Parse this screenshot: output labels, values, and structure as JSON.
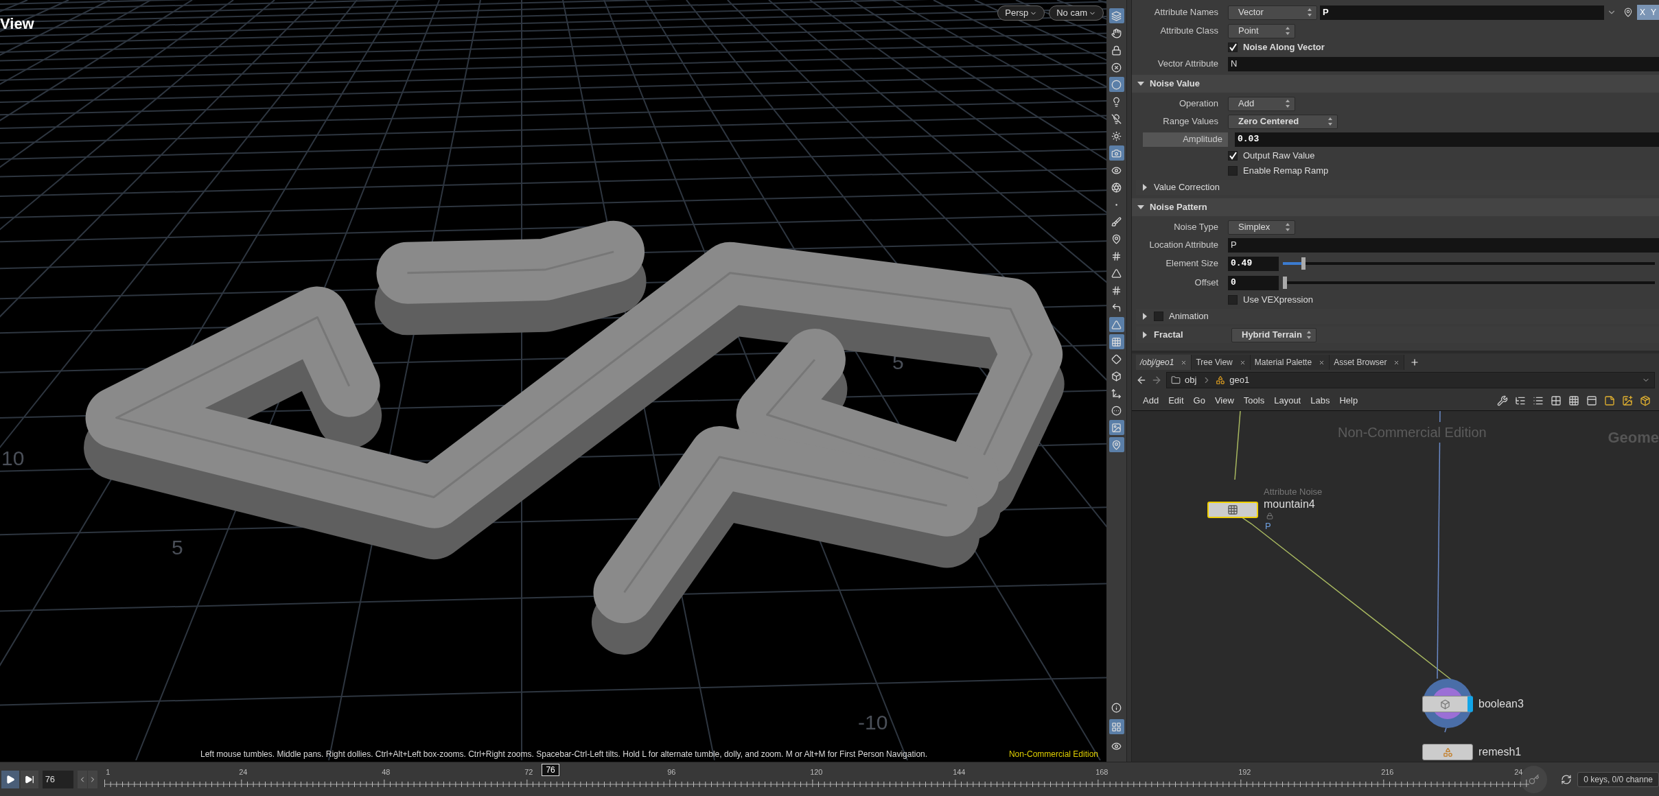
{
  "viewport": {
    "title": "View",
    "camera_menus": [
      "Persp",
      "No cam"
    ],
    "grid_labels": [
      "10",
      "5",
      "5",
      "-10"
    ],
    "tools": [
      {
        "selected": true
      },
      {
        "selected": false
      },
      {
        "selected": false
      },
      {
        "selected": false
      },
      {
        "selected": true
      },
      {
        "selected": false
      },
      {
        "selected": false
      },
      {
        "selected": false
      },
      {
        "selected": true
      },
      {
        "selected": false
      },
      {
        "selected": false
      },
      {
        "selected": false
      },
      {
        "selected": false
      },
      {
        "selected": false
      },
      {
        "selected": false
      },
      {
        "selected": false
      },
      {
        "selected": false
      },
      {
        "selected": false
      },
      {
        "selected": true
      },
      {
        "selected": true
      },
      {
        "selected": false
      },
      {
        "selected": false
      },
      {
        "selected": false
      },
      {
        "selected": false
      },
      {
        "selected": true
      },
      {
        "selected": true
      }
    ],
    "bottom_tools": [
      {
        "selected": false
      },
      {
        "selected": true
      },
      {
        "selected": false
      }
    ],
    "hint": "Left mouse tumbles. Middle pans. Right dollies. Ctrl+Alt+Left box-zooms. Ctrl+Right zooms. Spacebar-Ctrl-Left tilts. Hold L for alternate tumble, dolly, and zoom. M or Alt+M for First Person Navigation.",
    "edition": "Non-Commercial Edition"
  },
  "parameters": [
    {
      "kind": "menu_field",
      "label": "Attribute Names",
      "menu": "Vector",
      "value": "P",
      "components": [
        "X",
        "Y"
      ]
    },
    {
      "kind": "menu",
      "label": "Attribute Class",
      "value": "Point",
      "bold": false
    },
    {
      "kind": "checkbox",
      "label": "Noise Along Vector",
      "checked": true,
      "bold": true
    },
    {
      "kind": "text",
      "label": "Vector Attribute",
      "value": "N"
    },
    {
      "kind": "section",
      "label": "Noise Value",
      "expanded": true
    },
    {
      "kind": "menu",
      "label": "Operation",
      "value": "Add",
      "bold": false
    },
    {
      "kind": "menu",
      "label": "Range Values",
      "value": "Zero Centered",
      "bold": true
    },
    {
      "kind": "number",
      "label": "Amplitude",
      "value": "0.03",
      "highlighted": true
    },
    {
      "kind": "checkbox",
      "label": "Output Raw Value",
      "checked": true,
      "bold": false
    },
    {
      "kind": "checkbox",
      "label": "Enable Remap Ramp",
      "checked": false,
      "bold": false
    },
    {
      "kind": "folder",
      "label": "Value Correction",
      "expanded": false
    },
    {
      "kind": "section",
      "label": "Noise Pattern",
      "expanded": true
    },
    {
      "kind": "menu",
      "label": "Noise Type",
      "value": "Simplex",
      "bold": false
    },
    {
      "kind": "text",
      "label": "Location Attribute",
      "value": "P"
    },
    {
      "kind": "slider",
      "label": "Element Size",
      "value": "0.49",
      "level": 0.05
    },
    {
      "kind": "slider",
      "label": "Offset",
      "value": "0",
      "level": 0
    },
    {
      "kind": "checkbox",
      "label": "Use VEXpression",
      "checked": false,
      "bold": false
    },
    {
      "kind": "folder",
      "label": "Animation",
      "expanded": false,
      "enabled": false
    },
    {
      "kind": "folder_menu",
      "label": "Fractal",
      "value": "Hybrid Terrain"
    }
  ],
  "network": {
    "tabs": [
      {
        "label": "/obj/geo1",
        "selected": true
      },
      {
        "label": "Tree View",
        "selected": false
      },
      {
        "label": "Material Palette",
        "selected": false
      },
      {
        "label": "Asset Browser",
        "selected": false
      }
    ],
    "path": [
      "obj",
      "geo1"
    ],
    "menu": [
      "Add",
      "Edit",
      "Go",
      "View",
      "Tools",
      "Layout",
      "Labs",
      "Help"
    ],
    "watermark": "Non-Commercial Edition",
    "context": "Geome",
    "nodes": [
      {
        "kind": "noise",
        "type_label": "Attribute Noise",
        "name": "mountain4",
        "attribute": "P",
        "selected": true,
        "display": false,
        "locked": true
      },
      {
        "kind": "boolean",
        "name": "boolean3",
        "selected": false,
        "display": true,
        "locked": false
      },
      {
        "kind": "remesh",
        "name": "remesh1",
        "selected": false,
        "display": false,
        "locked": false
      }
    ]
  },
  "timeline": {
    "frame": "76",
    "marker": "76",
    "ticks": [
      "1",
      "24",
      "48",
      "72",
      "96",
      "120",
      "144",
      "168",
      "192",
      "216",
      "24"
    ],
    "status": "0 keys, 0/0 channe"
  }
}
